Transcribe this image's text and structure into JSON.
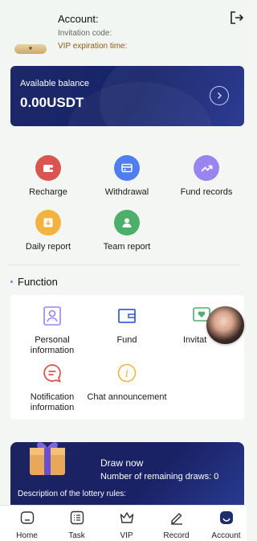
{
  "header": {
    "account_label": "Account:",
    "invitation_label": "Invitation code:",
    "vip_expiration_label": "VIP expiration time:",
    "vip_badge_text": "★"
  },
  "balance": {
    "label": "Available balance",
    "value": "0.00USDT"
  },
  "actions": [
    {
      "label": "Recharge",
      "icon": "wallet-icon",
      "color": "#d95650"
    },
    {
      "label": "Withdrawal",
      "icon": "card-icon",
      "color": "#4f7ef0"
    },
    {
      "label": "Fund records",
      "icon": "trend-up-icon",
      "color": "#9a84f0"
    },
    {
      "label": "Daily report",
      "icon": "download-box-icon",
      "color": "#f2b340"
    },
    {
      "label": "Team report",
      "icon": "user-icon",
      "color": "#4caf6a"
    }
  ],
  "function": {
    "title": "Function",
    "items": [
      {
        "label": "Personal information",
        "icon": "id-card-icon"
      },
      {
        "label": "Fund",
        "icon": "wallet-outline-icon"
      },
      {
        "label": "Invitat",
        "icon": "chat-heart-icon"
      },
      {
        "label": "Notification information",
        "icon": "message-icon"
      },
      {
        "label": "Chat announcement",
        "icon": "info-icon"
      }
    ]
  },
  "lottery": {
    "draw_now": "Draw now",
    "remaining": "Number of remaining draws: 0",
    "description": "Description of the lottery rules:"
  },
  "nav": [
    {
      "label": "Home",
      "icon": "home-icon"
    },
    {
      "label": "Task",
      "icon": "list-icon"
    },
    {
      "label": "VIP",
      "icon": "crown-icon"
    },
    {
      "label": "Record",
      "icon": "edit-icon"
    },
    {
      "label": "Account",
      "icon": "account-icon"
    }
  ]
}
